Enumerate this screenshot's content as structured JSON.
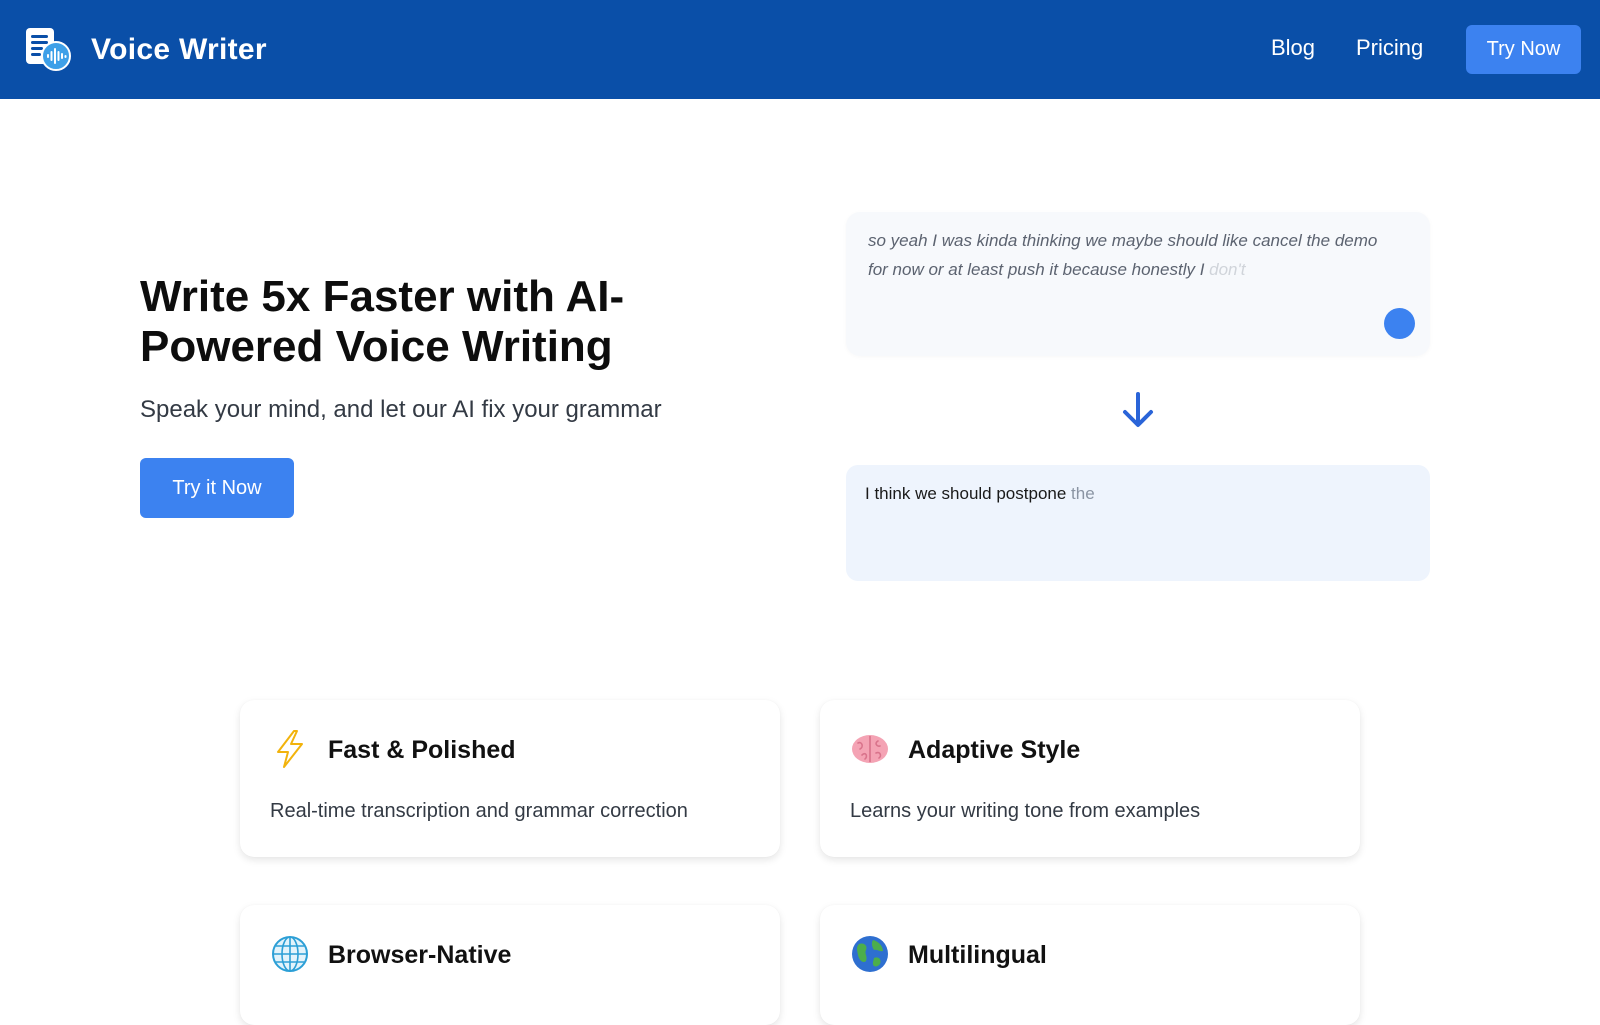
{
  "header": {
    "brand_name": "Voice Writer",
    "nav": {
      "blog_label": "Blog",
      "pricing_label": "Pricing",
      "try_label": "Try Now"
    },
    "background_color": "#0a4fa8",
    "accent_color": "#3c82f0"
  },
  "hero": {
    "title": "Write 5x Faster with AI-Powered Voice Writing",
    "subtitle": "Speak your mind, and let our AI fix your grammar",
    "cta_label": "Try it Now"
  },
  "demo": {
    "input_text": "so yeah I was kinda thinking we maybe should like cancel the demo for now or at least push it because honestly I ",
    "input_text_fading": "don't",
    "output_text": "I think we should postpone ",
    "output_text_fading": "the"
  },
  "features": [
    {
      "icon": "lightning-icon",
      "title": "Fast & Polished",
      "description": "Real-time transcription and grammar correction"
    },
    {
      "icon": "brain-icon",
      "title": "Adaptive Style",
      "description": "Learns your writing tone from examples"
    },
    {
      "icon": "globe-meridians-icon",
      "title": "Browser-Native",
      "description": ""
    },
    {
      "icon": "earth-globe-icon",
      "title": "Multilingual",
      "description": ""
    }
  ]
}
